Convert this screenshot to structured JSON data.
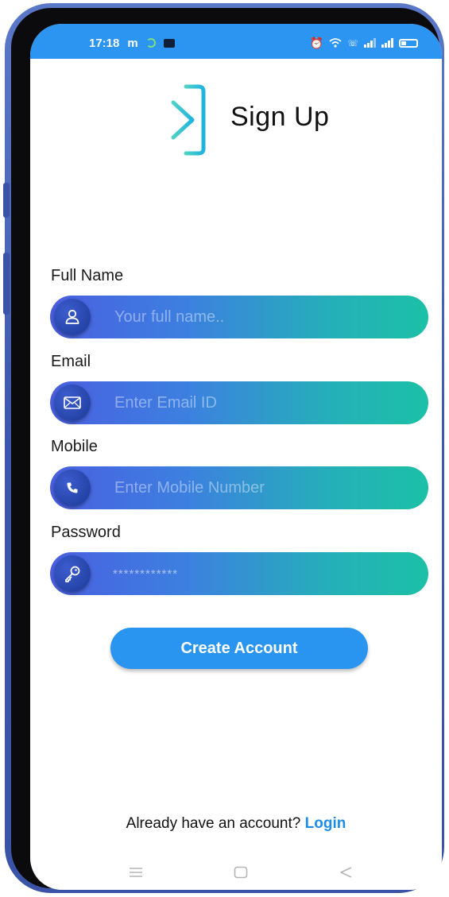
{
  "status_bar": {
    "time": "17:18",
    "carrier_icon": "m-icon",
    "icons": [
      "alarm-icon",
      "wifi-icon",
      "volte-icon",
      "signal-icon",
      "signal-icon",
      "battery-icon"
    ]
  },
  "header": {
    "title": "Sign Up",
    "logo_icon": "sign-in-arrow-icon"
  },
  "form": {
    "full_name": {
      "label": "Full Name",
      "placeholder": "Your full name..",
      "icon": "user-icon"
    },
    "email": {
      "label": "Email",
      "placeholder": "Enter Email ID",
      "icon": "envelope-icon"
    },
    "mobile": {
      "label": "Mobile",
      "placeholder": "Enter Mobile Number",
      "icon": "phone-icon"
    },
    "password": {
      "label": "Password",
      "value": "************",
      "icon": "key-icon"
    }
  },
  "create_account_label": "Create Account",
  "footer": {
    "prompt": "Already have an account?",
    "login_label": "Login"
  },
  "nav": {
    "menu_icon": "menu-icon",
    "home_icon": "home-icon",
    "back_icon": "back-icon"
  },
  "colors": {
    "accent": "#2a95f0",
    "gradient_start": "#4a5fe0",
    "gradient_end": "#1cc0a6",
    "logo_teal": "#29c6c6"
  }
}
